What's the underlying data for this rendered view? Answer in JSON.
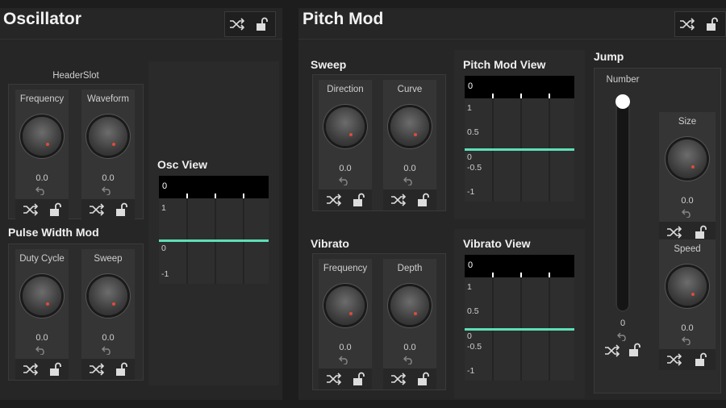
{
  "colors": {
    "accent": "#5de0b8",
    "knob_indicator": "#e04a3a",
    "background": "#1d1d1d"
  },
  "oscillator": {
    "title": "Oscillator",
    "header_slot_label": "HeaderSlot",
    "knobs": [
      {
        "label": "Frequency",
        "value": "0.0"
      },
      {
        "label": "Waveform",
        "value": "0.0"
      }
    ],
    "pulse_width_mod": {
      "title": "Pulse Width Mod",
      "knobs": [
        {
          "label": "Duty Cycle",
          "value": "0.0"
        },
        {
          "label": "Sweep",
          "value": "0.0"
        }
      ]
    },
    "view": {
      "title": "Osc View",
      "top_value": "0",
      "y_labels": [
        "1",
        "0",
        "-1"
      ]
    }
  },
  "pitch_mod": {
    "title": "Pitch Mod",
    "sweep": {
      "title": "Sweep",
      "knobs": [
        {
          "label": "Direction",
          "value": "0.0"
        },
        {
          "label": "Curve",
          "value": "0.0"
        }
      ]
    },
    "vibrato": {
      "title": "Vibrato",
      "knobs": [
        {
          "label": "Frequency",
          "value": "0.0"
        },
        {
          "label": "Depth",
          "value": "0.0"
        }
      ]
    },
    "pitch_view": {
      "title": "Pitch Mod View",
      "top_value": "0",
      "y_labels": [
        "1",
        "0.5",
        "0",
        "-0.5",
        "-1"
      ]
    },
    "vibrato_view": {
      "title": "Vibrato View",
      "top_value": "0",
      "y_labels": [
        "1",
        "0.5",
        "0",
        "-0.5",
        "-1"
      ]
    },
    "jump": {
      "title": "Jump",
      "number": {
        "label": "Number",
        "value": "0",
        "level": 1.0
      },
      "knobs": [
        {
          "label": "Size",
          "value": "0.0"
        },
        {
          "label": "Speed",
          "value": "0.0"
        }
      ]
    }
  },
  "icons": {
    "randomize": "shuffle-icon",
    "lock": "lock-open-icon",
    "reset": "undo-icon"
  }
}
